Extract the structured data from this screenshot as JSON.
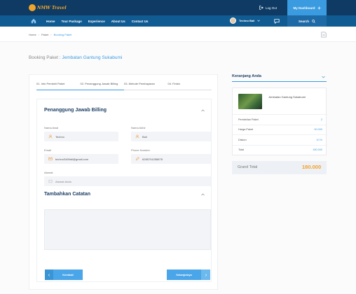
{
  "header": {
    "logo_text": "NMW Travel",
    "logout_label": "Log Out",
    "dashboard_label": "My Dashboard"
  },
  "nav": {
    "items": [
      "Home",
      "Tour Package",
      "Experience",
      "About Us",
      "Contact Us"
    ],
    "user_name": "Techno Bali",
    "search_label": "Search"
  },
  "breadcrumb": {
    "items": [
      "Home",
      "Paket",
      "Booking Paket"
    ]
  },
  "page": {
    "title_prefix": "Booking Paket :",
    "title_highlight": "Jembatan Gantung Sukabumi"
  },
  "steps": [
    "01. Info Pembeli Paket",
    "02. Penanggung Jawab Billing",
    "03. Metode Pembayaran",
    "04. Finish"
  ],
  "billing": {
    "section_title": "Penanggung Jawab Billing",
    "first_name_label": "Nama Awal",
    "first_name_value": "Techno",
    "last_name_label": "Nama Akhir",
    "last_name_value": "Bali",
    "email_label": "Email",
    "email_value": "techno3469ali@gmail.com",
    "phone_label": "Phone Number",
    "phone_value": "6285704258878",
    "address_label": "Alamat",
    "address_placeholder": "Alamat Anda"
  },
  "notes": {
    "section_title": "Tambahkan Catatan"
  },
  "buttons": {
    "back_label": "Kembali",
    "next_label": "Selanjutnya"
  },
  "cart": {
    "title": "Keranjang Anda",
    "item_name": "Jembatan Gantung Sukabumi",
    "rows": [
      {
        "label": "Pembelian Paket",
        "value": "2"
      },
      {
        "label": "Harga Paket",
        "value": "90.000"
      },
      {
        "label": "Diskon",
        "value": "10 %"
      },
      {
        "label": "Total",
        "value": "180.000"
      }
    ],
    "grand_total_label": "Grand Total",
    "grand_total_value": "180.000"
  },
  "colors": {
    "topbar": "#0e3a63",
    "navbar": "#115b93",
    "accent": "#3a9be0",
    "orange": "#f5a02a"
  }
}
